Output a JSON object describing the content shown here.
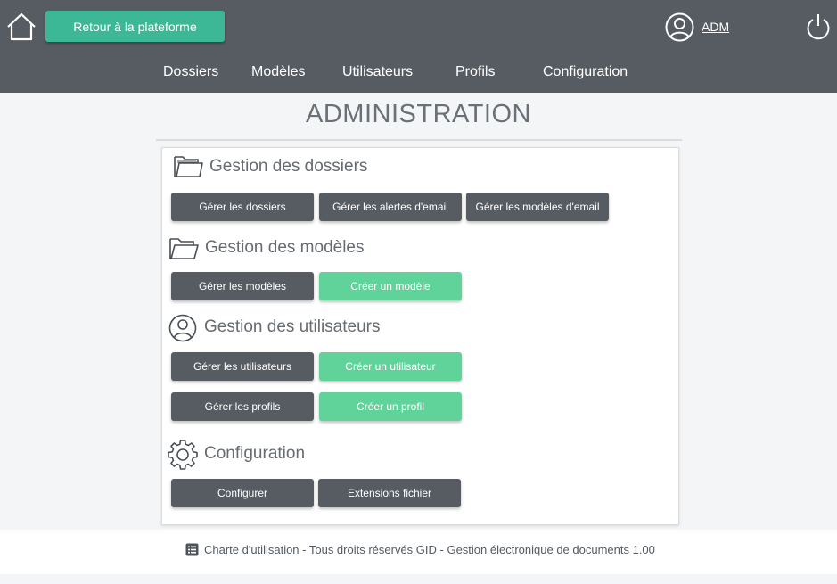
{
  "header": {
    "return_label": "Retour à la plateforme",
    "user_name": "ADM",
    "nav": [
      {
        "label": "Dossiers"
      },
      {
        "label": "Modèles"
      },
      {
        "label": "Utilisateurs"
      },
      {
        "label": "Profils"
      },
      {
        "label": "Configuration"
      }
    ]
  },
  "page": {
    "title": "ADMINISTRATION"
  },
  "sections": {
    "dossiers": {
      "title": "Gestion des dossiers",
      "icon": "folder-stack-icon",
      "buttons": [
        "Gérer les dossiers",
        "Gérer les alertes d'email",
        "Gérer les modèles d'email"
      ]
    },
    "modeles": {
      "title": "Gestion des modèles",
      "icon": "open-folder-icon",
      "buttons": [
        "Gérer les modèles",
        "Créer un modèle"
      ]
    },
    "utilisateurs": {
      "title": "Gestion des utilisateurs",
      "icon": "user-circle-icon",
      "buttons": [
        "Gérer les utilisateurs",
        "Créer un utilisateur",
        "Gérer les profils",
        "Créer un profil"
      ]
    },
    "configuration": {
      "title": "Configuration",
      "icon": "gear-icon",
      "buttons": [
        "Configurer",
        "Extensions fichier"
      ]
    }
  },
  "footer": {
    "link": "Charte d'utilisation",
    "text": " - Tous droits réservés GID - Gestion électronique de documents 1.00"
  },
  "colors": {
    "header_bg": "#575c63",
    "primary_green": "#3db896",
    "create_green": "#5fd39a",
    "dark_button": "#575c63"
  }
}
